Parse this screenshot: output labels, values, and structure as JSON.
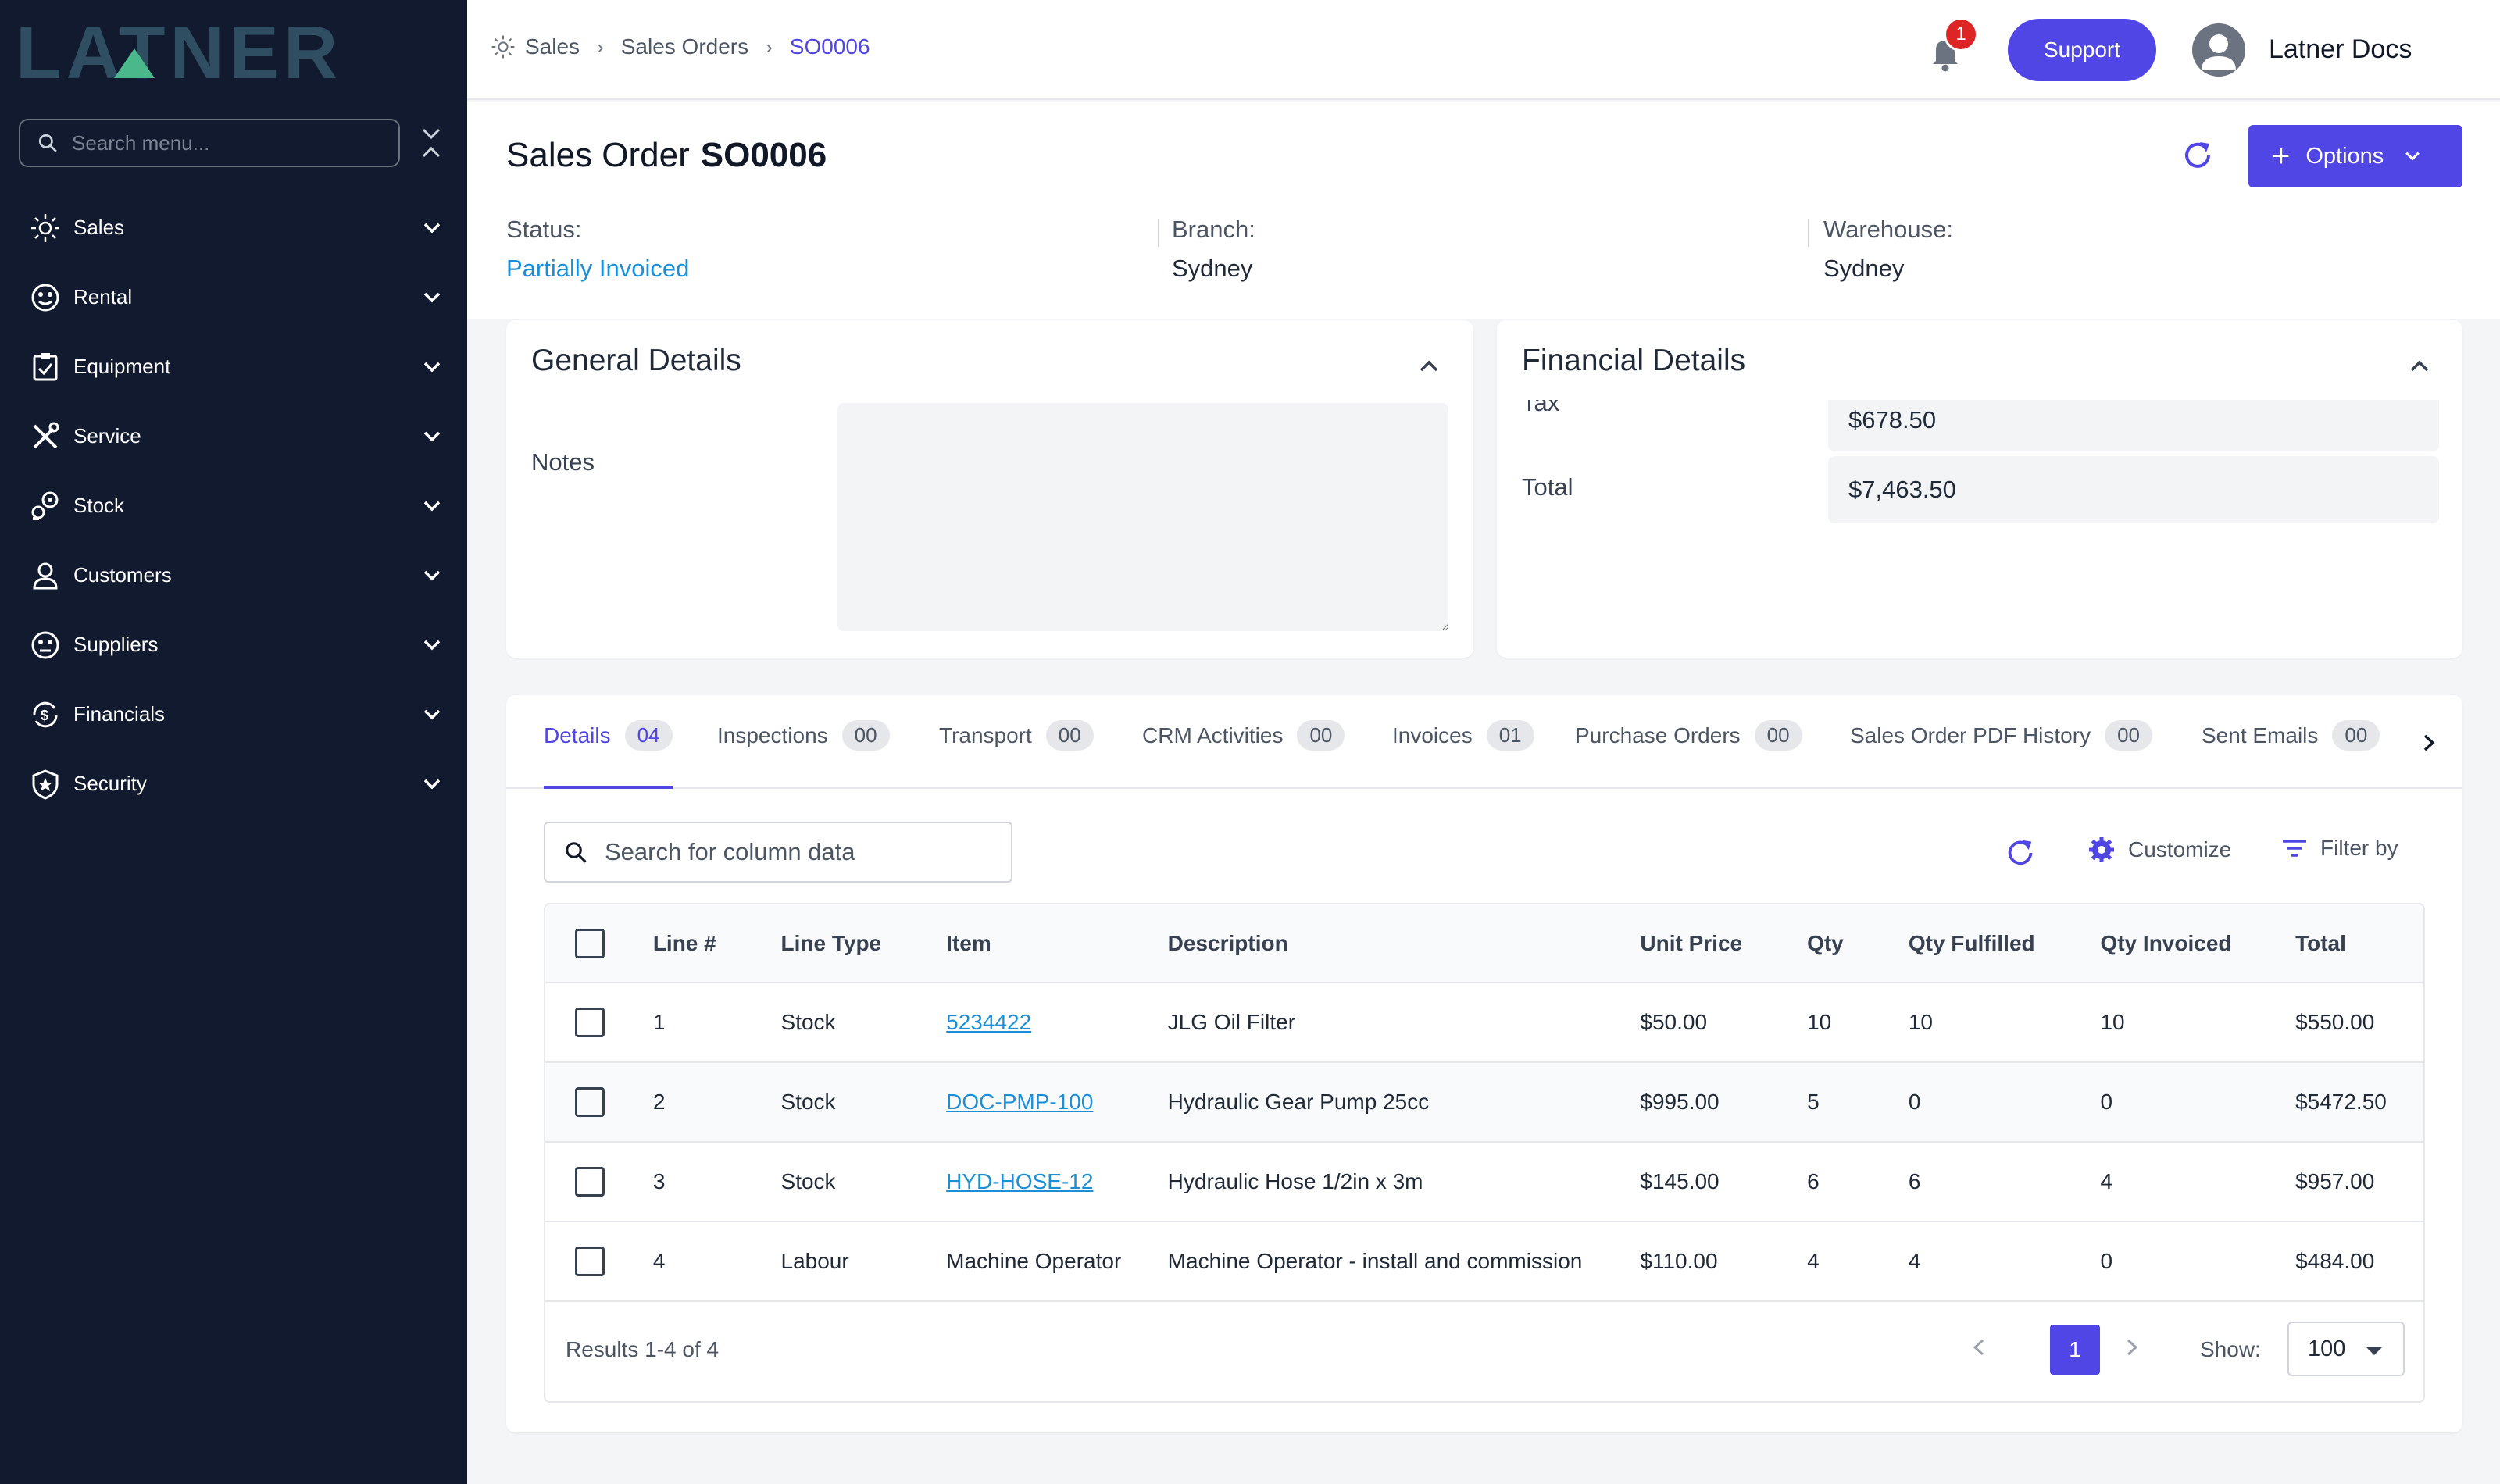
{
  "app": {
    "logo_text": "LATNER"
  },
  "sidebar": {
    "search_placeholder": "Search menu...",
    "items": [
      {
        "label": "Sales",
        "icon": "sun-icon"
      },
      {
        "label": "Rental",
        "icon": "rental-icon"
      },
      {
        "label": "Equipment",
        "icon": "clipboard-check-icon"
      },
      {
        "label": "Service",
        "icon": "tools-icon"
      },
      {
        "label": "Stock",
        "icon": "stock-icon"
      },
      {
        "label": "Customers",
        "icon": "user-icon"
      },
      {
        "label": "Suppliers",
        "icon": "supplier-icon"
      },
      {
        "label": "Financials",
        "icon": "dollar-cycle-icon"
      },
      {
        "label": "Security",
        "icon": "shield-icon"
      }
    ]
  },
  "topbar": {
    "breadcrumb": [
      "Sales",
      "Sales Orders",
      "SO0006"
    ],
    "notification_count": "1",
    "support_label": "Support",
    "user_name": "Latner Docs"
  },
  "header": {
    "title_prefix": "Sales Order",
    "order_number": "SO0006",
    "options_label": "Options",
    "status_label": "Status:",
    "status_value": "Partially Invoiced",
    "branch_label": "Branch:",
    "branch_value": "Sydney",
    "warehouse_label": "Warehouse:",
    "warehouse_value": "Sydney"
  },
  "general": {
    "title": "General Details",
    "notes_label": "Notes",
    "notes_value": ""
  },
  "financial": {
    "title": "Financial Details",
    "tax_label": "Tax",
    "tax_value": "$678.50",
    "total_label": "Total",
    "total_value": "$7,463.50"
  },
  "tabs": [
    {
      "label": "Details",
      "count": "04"
    },
    {
      "label": "Inspections",
      "count": "00"
    },
    {
      "label": "Transport",
      "count": "00"
    },
    {
      "label": "CRM Activities",
      "count": "00"
    },
    {
      "label": "Invoices",
      "count": "01"
    },
    {
      "label": "Purchase Orders",
      "count": "00"
    },
    {
      "label": "Sales Order PDF History",
      "count": "00"
    },
    {
      "label": "Sent Emails",
      "count": "00"
    }
  ],
  "toolbar": {
    "search_placeholder": "Search for column data",
    "customize_label": "Customize",
    "filter_label": "Filter by"
  },
  "table": {
    "columns": [
      "Line #",
      "Line Type",
      "Item",
      "Description",
      "Unit Price",
      "Qty",
      "Qty Fulfilled",
      "Qty Invoiced",
      "Total"
    ],
    "rows": [
      {
        "line": "1",
        "type": "Stock",
        "item": "5234422",
        "item_link": true,
        "description": "JLG Oil Filter",
        "unit_price": "$50.00",
        "qty": "10",
        "fulfilled": "10",
        "invoiced": "10",
        "total": "$550.00"
      },
      {
        "line": "2",
        "type": "Stock",
        "item": "DOC-PMP-100",
        "item_link": true,
        "description": "Hydraulic Gear Pump 25cc",
        "unit_price": "$995.00",
        "qty": "5",
        "fulfilled": "0",
        "invoiced": "0",
        "total": "$5472.50"
      },
      {
        "line": "3",
        "type": "Stock",
        "item": "HYD-HOSE-12",
        "item_link": true,
        "description": "Hydraulic Hose 1/2in x 3m",
        "unit_price": "$145.00",
        "qty": "6",
        "fulfilled": "6",
        "invoiced": "4",
        "total": "$957.00"
      },
      {
        "line": "4",
        "type": "Labour",
        "item": "Machine Operator",
        "item_link": false,
        "description": "Machine Operator - install and commission",
        "unit_price": "$110.00",
        "qty": "4",
        "fulfilled": "4",
        "invoiced": "0",
        "total": "$484.00"
      }
    ],
    "results_text": "Results 1-4 of 4",
    "page": "1",
    "show_label": "Show:",
    "page_size": "100"
  },
  "colors": {
    "sidebar_bg": "#111a2e",
    "accent": "#4f46e5",
    "link": "#1a8fd8",
    "logo": "#2f4e62",
    "logo_accent": "#4ab88a"
  }
}
